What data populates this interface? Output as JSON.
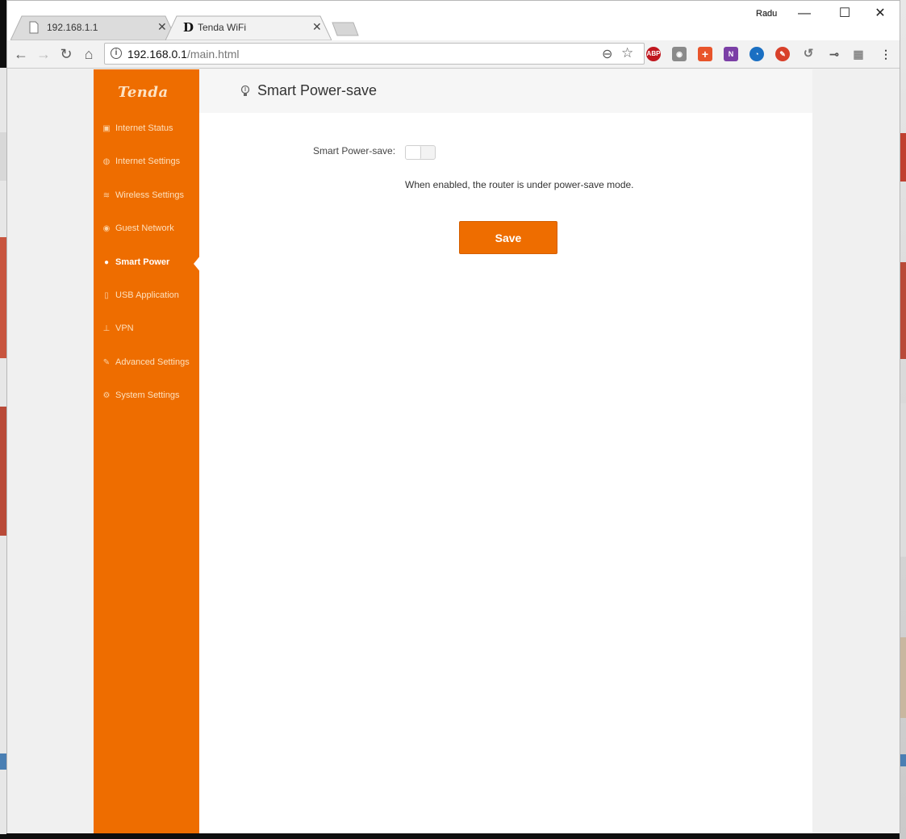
{
  "browser": {
    "tabs": [
      {
        "title": "192.168.1.1",
        "active": false
      },
      {
        "title": "Tenda WiFi",
        "active": true
      }
    ],
    "profile_name": "Radu",
    "url_host": "192.168.0.1",
    "url_path": "/main.html",
    "window_controls": {
      "minimize": "—",
      "maximize": "☐",
      "close": "✕"
    },
    "extensions": [
      "ABP",
      "camera-icon",
      "plus-icon",
      "onenote-icon",
      "pie-icon",
      "brush-icon",
      "history-icon",
      "pin-icon",
      "grid-icon"
    ]
  },
  "router": {
    "brand": "Tenda",
    "accent": "#ee6d00",
    "nav": [
      {
        "label": "Internet Status",
        "icon": "monitor-icon",
        "active": false
      },
      {
        "label": "Internet Settings",
        "icon": "globe-icon",
        "active": false
      },
      {
        "label": "Wireless Settings",
        "icon": "wifi-icon",
        "active": false
      },
      {
        "label": "Guest Network",
        "icon": "guest-icon",
        "active": false
      },
      {
        "label": "Smart Power",
        "icon": "bulb-icon",
        "active": true
      },
      {
        "label": "USB Application",
        "icon": "usb-icon",
        "active": false
      },
      {
        "label": "VPN",
        "icon": "vpn-icon",
        "active": false
      },
      {
        "label": "Advanced Settings",
        "icon": "wrench-icon",
        "active": false
      },
      {
        "label": "System Settings",
        "icon": "gear-icon",
        "active": false
      }
    ],
    "page": {
      "title": "Smart Power-save",
      "field_label": "Smart Power-save:",
      "toggle_on": false,
      "hint": "When enabled, the router is under power-save mode.",
      "save_label": "Save"
    }
  }
}
